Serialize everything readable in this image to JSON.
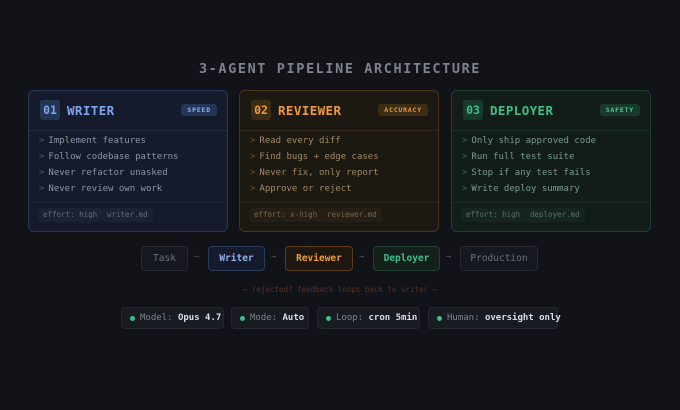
{
  "title": "3-AGENT PIPELINE ARCHITECTURE",
  "agents": [
    {
      "number": "01",
      "name": "WRITER",
      "badge": "SPEED",
      "tasks": [
        "Implement features",
        "Follow codebase patterns",
        "Never refactor unasked",
        "Never review own work"
      ],
      "effort": "effort: high",
      "file": "writer.md",
      "accent": "#7ea5f0"
    },
    {
      "number": "02",
      "name": "REVIEWER",
      "badge": "ACCURACY",
      "tasks": [
        "Read every diff",
        "Find bugs + edge cases",
        "Never fix, only report",
        "Approve or reject"
      ],
      "effort": "effort: x-high",
      "file": "reviewer.md",
      "accent": "#ee9c3a"
    },
    {
      "number": "03",
      "name": "DEPLOYER",
      "badge": "SAFETY",
      "tasks": [
        "Only ship approved code",
        "Run full test suite",
        "Stop if any test fails",
        "Write deploy summary"
      ],
      "effort": "effort: high",
      "file": "deployer.md",
      "accent": "#3fbf87"
    }
  ],
  "bullet": ">",
  "flow": {
    "steps": [
      "Task",
      "Writer",
      "Reviewer",
      "Deployer",
      "Production"
    ],
    "arrow": "→",
    "loop_note": "← rejected? feedback loops back to writer ←"
  },
  "status": [
    {
      "label": "Model:",
      "value": "Opus 4.7"
    },
    {
      "label": "Mode:",
      "value": "Auto"
    },
    {
      "label": "Loop:",
      "value": "cron 5min"
    },
    {
      "label": "Human:",
      "value": "oversight only"
    }
  ],
  "status_dot_color": "#3fbf87"
}
